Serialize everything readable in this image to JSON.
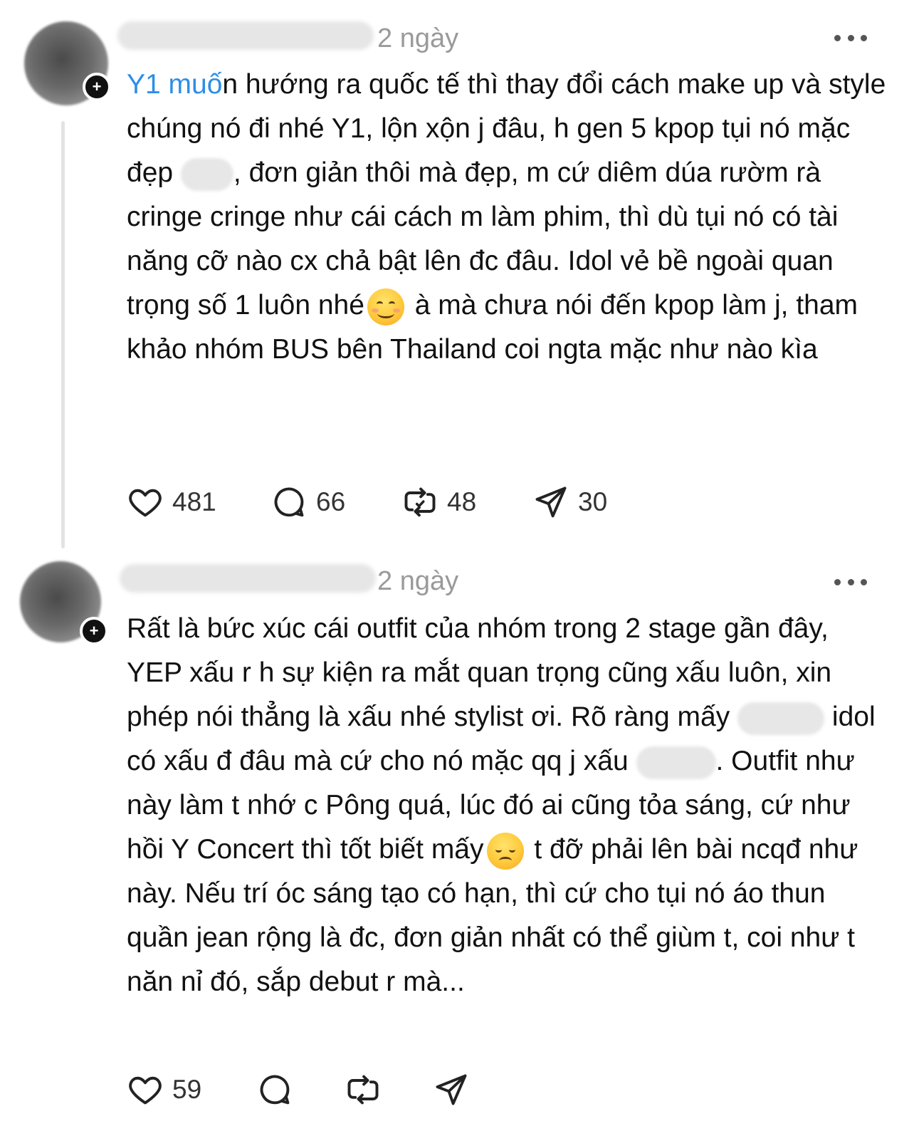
{
  "posts": [
    {
      "username": "username",
      "timestamp": "2 ngày",
      "text": {
        "mention": "Y1 muố",
        "seg1": "n hướng ra quốc tế thì thay đổi cách make up và style chúng nó đi nhé Y1, lộn xộn j đâu, h gen 5 kpop tụi nó mặc đẹp ",
        "seg2": ", đơn giản thôi mà đẹp, m cứ diêm dúa rườm rà cringe cringe như cái cách m làm phim, thì dù tụi nó có tài năng cỡ nào cx chả bật lên đc đâu. Idol vẻ bề ngoài quan trọng số 1 luôn nhé",
        "seg3": " à mà chưa nói đến kpop làm j, tham khảo nhóm BUS bên Thailand coi ngta mặc như nào kìa"
      },
      "actions": {
        "likes": "481",
        "replies": "66",
        "reposts": "48",
        "shares": "30"
      }
    },
    {
      "username": "username",
      "timestamp": "2 ngày",
      "text": {
        "seg1": "Rất là bức xúc cái outfit của nhóm trong 2 stage gần đây, YEP xấu r h sự kiện ra mắt quan trọng cũng xấu luôn, xin phép nói thẳng là xấu nhé stylist ơi. Rõ ràng mấy ",
        "seg2": " idol có xấu đ đâu mà cứ cho nó mặc qq j xấu ",
        "seg3": ". Outfit như này làm t nhớ c Pông quá, lúc đó ai cũng tỏa sáng, cứ như hồi Y Concert thì tốt biết mấy",
        "seg4": " t đỡ phải lên bài ncqđ như này. Nếu trí óc sáng tạo có hạn, thì cứ cho tụi nó áo thun quần jean rộng là đc, đơn giản nhất có thể giùm t, coi như t năn nỉ đó, sắp debut r mà..."
      },
      "actions": {
        "likes": "59"
      }
    }
  ],
  "icons": [
    "more-icon",
    "heart-icon",
    "comment-icon",
    "repost-icon",
    "share-icon",
    "smiling-face-emoji",
    "pensive-face-emoji",
    "plus-icon"
  ],
  "colors": {
    "mention": "#2d8ee8",
    "timestamp": "#9a9a9a",
    "text": "#111111"
  }
}
